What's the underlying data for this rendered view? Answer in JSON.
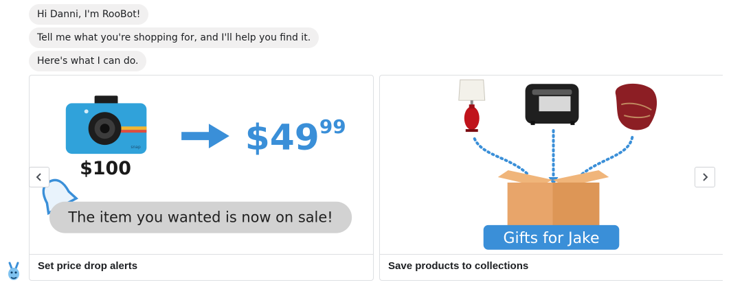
{
  "chat": {
    "messages": [
      "Hi Danni, I'm RooBot!",
      "Tell me what you're shopping for, and I'll help you find it.",
      "Here's what I can do."
    ]
  },
  "cards": [
    {
      "title": "Set price drop alerts",
      "old_price": "$100",
      "new_price_dollars": "$49",
      "new_price_cents": "99",
      "camera_brand": "snap",
      "alert_text": "The item you wanted is now on sale!"
    },
    {
      "title": "Save products to collections",
      "collection_label": "Gifts for Jake"
    }
  ],
  "colors": {
    "accent_blue": "#3a8fd8",
    "bubble_bg": "#f1f0f0",
    "box_tan": "#e8a56a"
  },
  "icons": {
    "prev": "chevron-left-icon",
    "next": "chevron-right-icon",
    "bell": "bell-icon",
    "bot": "roobot-avatar-icon"
  }
}
